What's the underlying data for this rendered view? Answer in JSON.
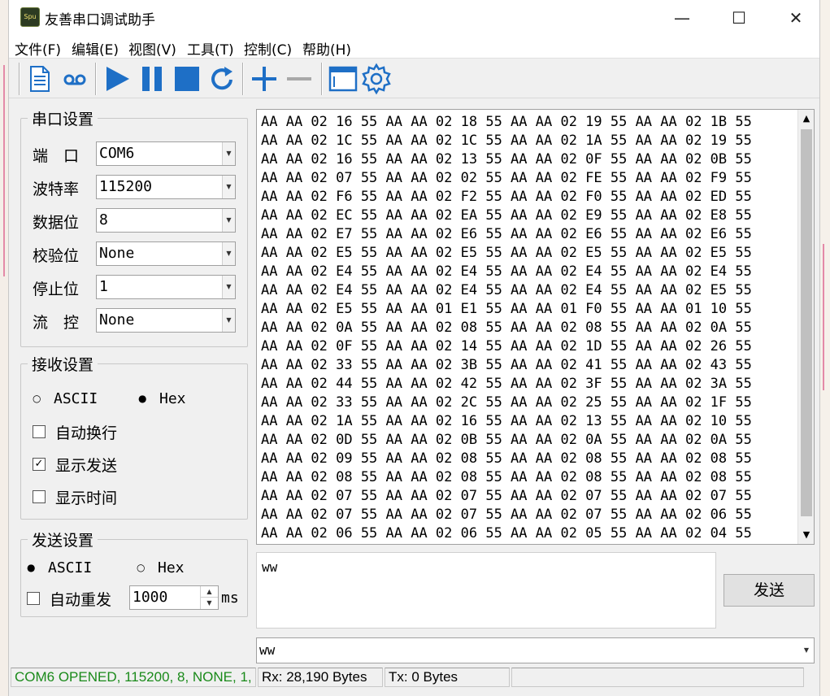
{
  "window": {
    "title": "友善串口调试助手",
    "icon_text": "Spu",
    "min_glyph": "—",
    "max_glyph": "☐",
    "close_glyph": "✕"
  },
  "menu": [
    "文件(F)",
    "编辑(E)",
    "视图(V)",
    "工具(T)",
    "控制(C)",
    "帮助(H)"
  ],
  "toolbar": {
    "icons": [
      "new-file-icon",
      "record-icon",
      "play-icon",
      "pause-icon",
      "stop-icon",
      "refresh-icon",
      "add-icon",
      "remove-icon",
      "window-icon",
      "settings-icon"
    ],
    "accent": "#1e6fc6"
  },
  "serial_settings": {
    "title": "串口设置",
    "port_label": "端　口",
    "port_value": "COM6",
    "baud_label": "波特率",
    "baud_value": "115200",
    "databits_label": "数据位",
    "databits_value": "8",
    "parity_label": "校验位",
    "parity_value": "None",
    "stopbits_label": "停止位",
    "stopbits_value": "1",
    "flow_label": "流　控",
    "flow_value": "None"
  },
  "receive_settings": {
    "title": "接收设置",
    "ascii_label": "ASCII",
    "hex_label": "Hex",
    "mode_selected": "Hex",
    "auto_wrap_label": "自动换行",
    "auto_wrap_checked": false,
    "show_send_label": "显示发送",
    "show_send_checked": true,
    "show_time_label": "显示时间",
    "show_time_checked": false
  },
  "send_settings": {
    "title": "发送设置",
    "ascii_label": "ASCII",
    "hex_label": "Hex",
    "mode_selected": "ASCII",
    "auto_resend_label": "自动重发",
    "auto_resend_checked": false,
    "interval_value": "1000",
    "interval_unit": "ms"
  },
  "receive_lines": [
    "AA AA 02 16 55 AA AA 02 18 55 AA AA 02 19 55 AA AA 02 1B 55",
    "AA AA 02 1C 55 AA AA 02 1C 55 AA AA 02 1A 55 AA AA 02 19 55",
    "AA AA 02 16 55 AA AA 02 13 55 AA AA 02 0F 55 AA AA 02 0B 55",
    "AA AA 02 07 55 AA AA 02 02 55 AA AA 02 FE 55 AA AA 02 F9 55",
    "AA AA 02 F6 55 AA AA 02 F2 55 AA AA 02 F0 55 AA AA 02 ED 55",
    "AA AA 02 EC 55 AA AA 02 EA 55 AA AA 02 E9 55 AA AA 02 E8 55",
    "AA AA 02 E7 55 AA AA 02 E6 55 AA AA 02 E6 55 AA AA 02 E6 55",
    "AA AA 02 E5 55 AA AA 02 E5 55 AA AA 02 E5 55 AA AA 02 E5 55",
    "AA AA 02 E4 55 AA AA 02 E4 55 AA AA 02 E4 55 AA AA 02 E4 55",
    "AA AA 02 E4 55 AA AA 02 E4 55 AA AA 02 E4 55 AA AA 02 E5 55",
    "AA AA 02 E5 55 AA AA 01 E1 55 AA AA 01 F0 55 AA AA 01 10 55",
    "AA AA 02 0A 55 AA AA 02 08 55 AA AA 02 08 55 AA AA 02 0A 55",
    "AA AA 02 0F 55 AA AA 02 14 55 AA AA 02 1D 55 AA AA 02 26 55",
    "AA AA 02 33 55 AA AA 02 3B 55 AA AA 02 41 55 AA AA 02 43 55",
    "AA AA 02 44 55 AA AA 02 42 55 AA AA 02 3F 55 AA AA 02 3A 55",
    "AA AA 02 33 55 AA AA 02 2C 55 AA AA 02 25 55 AA AA 02 1F 55",
    "AA AA 02 1A 55 AA AA 02 16 55 AA AA 02 13 55 AA AA 02 10 55",
    "AA AA 02 0D 55 AA AA 02 0B 55 AA AA 02 0A 55 AA AA 02 0A 55",
    "AA AA 02 09 55 AA AA 02 08 55 AA AA 02 08 55 AA AA 02 08 55",
    "AA AA 02 08 55 AA AA 02 08 55 AA AA 02 08 55 AA AA 02 08 55",
    "AA AA 02 07 55 AA AA 02 07 55 AA AA 02 07 55 AA AA 02 07 55",
    "AA AA 02 07 55 AA AA 02 07 55 AA AA 02 07 55 AA AA 02 06 55",
    "AA AA 02 06 55 AA AA 02 06 55 AA AA 02 05 55 AA AA 02 04 55"
  ],
  "send_text": "ww",
  "send_button_label": "发送",
  "send_history_value": "ww",
  "status": {
    "port_status": "COM6 OPENED, 115200, 8, NONE, 1,",
    "port_status_color": "#1a8a1a",
    "rx": "Rx: 28,190 Bytes",
    "tx": "Tx: 0 Bytes"
  }
}
